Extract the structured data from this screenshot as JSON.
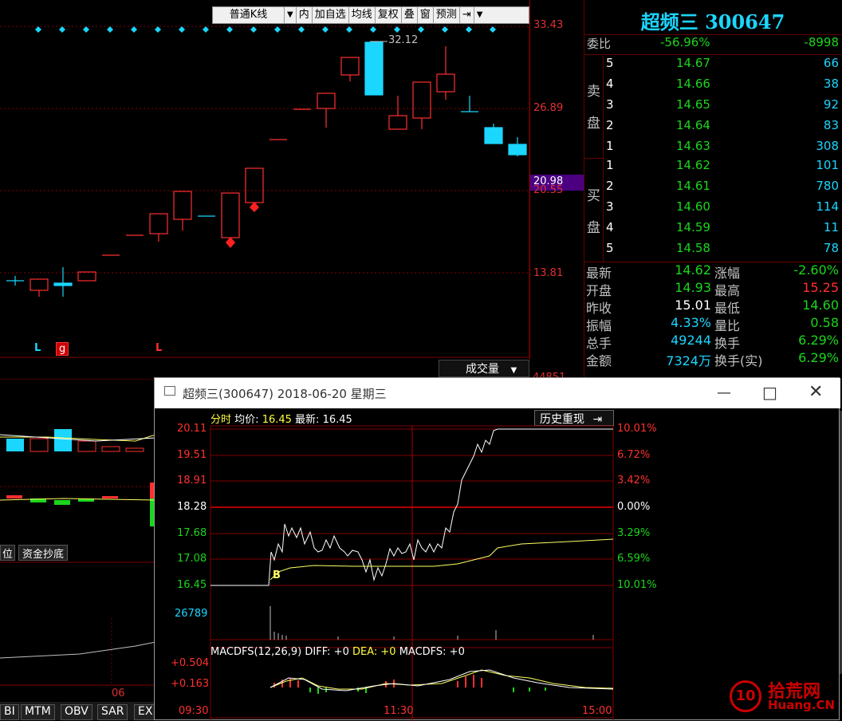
{
  "toolbar": {
    "items": [
      "普通K线",
      "▼",
      "内",
      "加自选",
      "均线",
      "复权",
      "叠",
      "窗",
      "预测",
      "⇥",
      "▼"
    ]
  },
  "kline": {
    "price_ticks": [
      "33.43",
      "26.89",
      "20.55",
      "13.81"
    ],
    "current_price_tag": "20.98",
    "peak_label": "32.12",
    "markers": [
      "L",
      "g",
      "L"
    ],
    "volume_label": "成交量",
    "volume_tick": "44851",
    "tab_left": "位",
    "tab_fund": "资金抄底",
    "month_label": "06"
  },
  "quote": {
    "title": "超频三 300647",
    "weibi_label": "委比",
    "weibi_pct": "-56.96%",
    "weibi_val": "-8998",
    "sell_label": [
      "卖",
      "盘"
    ],
    "buy_label": [
      "买",
      "盘"
    ],
    "sells": [
      {
        "lvl": "5",
        "price": "14.67",
        "vol": "66"
      },
      {
        "lvl": "4",
        "price": "14.66",
        "vol": "38"
      },
      {
        "lvl": "3",
        "price": "14.65",
        "vol": "92"
      },
      {
        "lvl": "2",
        "price": "14.64",
        "vol": "83"
      },
      {
        "lvl": "1",
        "price": "14.63",
        "vol": "308"
      }
    ],
    "buys": [
      {
        "lvl": "1",
        "price": "14.62",
        "vol": "101"
      },
      {
        "lvl": "2",
        "price": "14.61",
        "vol": "780"
      },
      {
        "lvl": "3",
        "price": "14.60",
        "vol": "114"
      },
      {
        "lvl": "4",
        "price": "14.59",
        "vol": "11"
      },
      {
        "lvl": "5",
        "price": "14.58",
        "vol": "78"
      }
    ],
    "stats": [
      {
        "l1": "最新",
        "v1": "14.62",
        "l2": "涨幅",
        "v2": "-2.60%"
      },
      {
        "l1": "开盘",
        "v1": "14.93",
        "l2": "最高",
        "v2": "15.25"
      },
      {
        "l1": "昨收",
        "v1": "15.01",
        "l2": "最低",
        "v2": "14.60"
      },
      {
        "l1": "振幅",
        "v1": "4.33%",
        "l2": "量比",
        "v2": "0.58"
      },
      {
        "l1": "总手",
        "v1": "49244",
        "l2": "换手",
        "v2": "6.29%"
      },
      {
        "l1": "金额",
        "v1": "7324万",
        "l2": "换手(实)",
        "v2": "6.29%"
      }
    ],
    "stats_colors": [
      [
        "#1bd61b",
        "#1bd61b"
      ],
      [
        "#1bd61b",
        "#ff3030"
      ],
      [
        "#ffffff",
        "#1bd61b"
      ],
      [
        "#1bd6ff",
        "#1bd61b"
      ],
      [
        "#1bd6ff",
        "#1bd61b"
      ],
      [
        "#1bd6ff",
        "#1bd61b"
      ]
    ]
  },
  "popup": {
    "title": "超频三(300647) 2018-06-20 星期三",
    "header_label": "分时",
    "avg_label": "均价:",
    "avg_value": "16.45",
    "last_label": "最新:",
    "last_value": "16.45",
    "history_btn": "历史重现",
    "left_ticks": [
      "20.11",
      "19.51",
      "18.91",
      "18.28",
      "17.68",
      "17.08",
      "16.45"
    ],
    "right_ticks": [
      "10.01%",
      "6.72%",
      "3.42%",
      "0.00%",
      "3.29%",
      "6.59%",
      "10.01%"
    ],
    "vol_tick": "26789",
    "macd_label": "MACDFS(12,26,9)",
    "diff_label": "DIFF: +0",
    "dea_label": "DEA: +0",
    "macdfs_label": "MACDFS: +0",
    "macd_ticks": [
      "+0.504",
      "+0.163"
    ],
    "time_labels": [
      "09:30",
      "11:30",
      "15:00"
    ],
    "buy_mark": "B"
  },
  "bottom_tabs": [
    "BI",
    "MTM",
    "OBV",
    "SAR",
    "EX"
  ],
  "logo": {
    "text1": "拾荒网",
    "text2": "Huang.CN",
    "num": "10"
  }
}
